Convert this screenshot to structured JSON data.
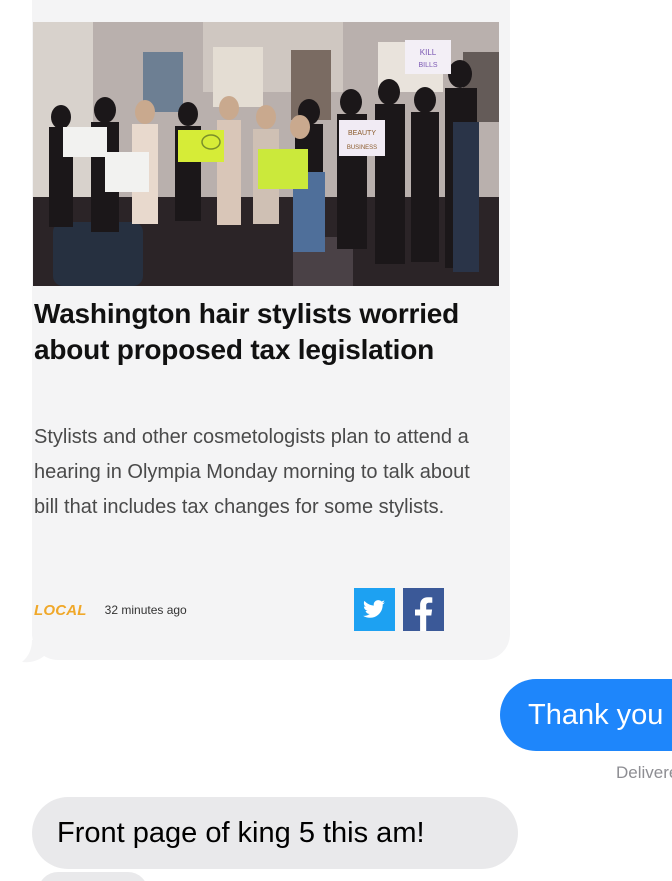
{
  "conversation": {
    "link_preview": {
      "headline": "Washington hair stylists worried about proposed tax legislation",
      "summary": "Stylists and other cosmetologists plan to attend a hearing in Olympia Monday morning to talk about bill that includes tax changes for some stylists.",
      "category": "LOCAL",
      "time_ago": "32 minutes ago",
      "photo_signs": {
        "kill_bills": "KILL BILLS",
        "beauty_business": "BEAUTY BUSINESS"
      },
      "share_icons": [
        "twitter-icon",
        "facebook-icon"
      ]
    },
    "outgoing_message": {
      "text": "Thank you",
      "status": "Delivered"
    },
    "incoming_message": {
      "text": "Front page of king 5 this am!"
    }
  },
  "colors": {
    "incoming_bubble": "#e9e9eb",
    "outgoing_bubble": "#1e86fb",
    "card_background": "#f4f4f5",
    "category_accent": "#f0a82a",
    "twitter": "#1da1f2",
    "facebook": "#3b5998"
  }
}
